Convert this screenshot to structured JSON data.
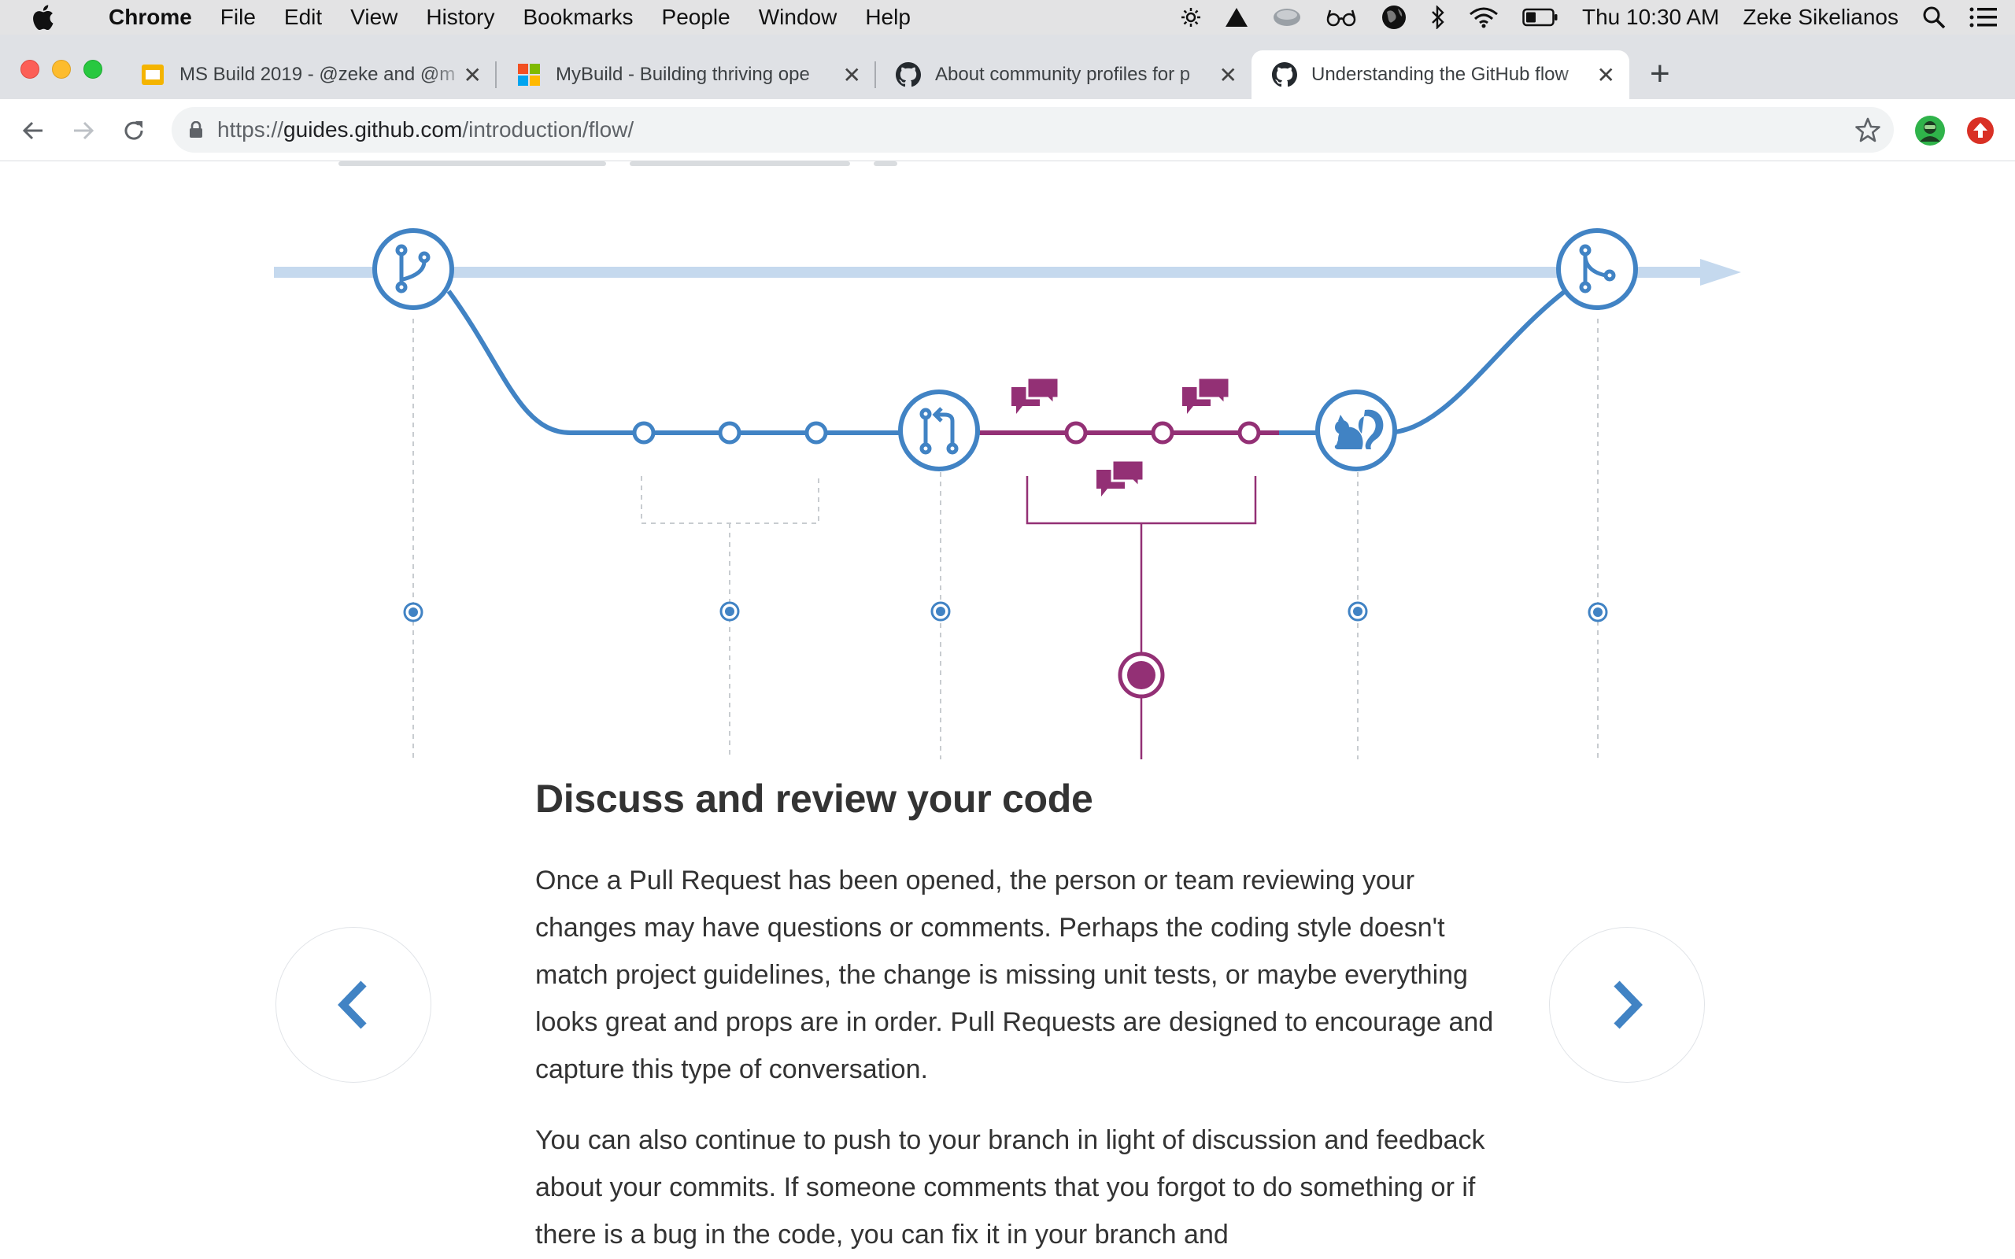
{
  "menubar": {
    "app": "Chrome",
    "items": [
      "File",
      "Edit",
      "View",
      "History",
      "Bookmarks",
      "People",
      "Window",
      "Help"
    ],
    "clock": "Thu 10:30 AM",
    "user": "Zeke Sikelianos"
  },
  "tabs": [
    {
      "title": "MS Build 2019 - @zeke and @m",
      "icon": "slides-icon"
    },
    {
      "title": "MyBuild - Building thriving ope",
      "icon": "microsoft-icon"
    },
    {
      "title": "About community profiles for p",
      "icon": "github-icon"
    },
    {
      "title": "Understanding the GitHub flow",
      "icon": "github-icon",
      "active": true
    }
  ],
  "toolbar": {
    "url_prefix": "https://",
    "url_host": "guides.github.com",
    "url_path": "/introduction/flow/"
  },
  "article": {
    "heading": "Discuss and review your code",
    "paragraph1": "Once a Pull Request has been opened, the person or team reviewing your changes may have questions or comments. Perhaps the coding style doesn't match project guidelines, the change is missing unit tests, or maybe everything looks great and props are in order. Pull Requests are designed to encourage and capture this type of conversation.",
    "paragraph2": "You can also continue to push to your branch in light of discussion and feedback about your commits. If someone comments that you forgot to do something or if there is a bug in the code, you can fix it in your branch and"
  },
  "colors": {
    "flow_blue": "#4183c4",
    "flow_light_blue": "#c5d9ee",
    "discussion_purple": "#933075",
    "tabstrip": "#dfe1e5",
    "menubar": "#e3e3e4"
  }
}
